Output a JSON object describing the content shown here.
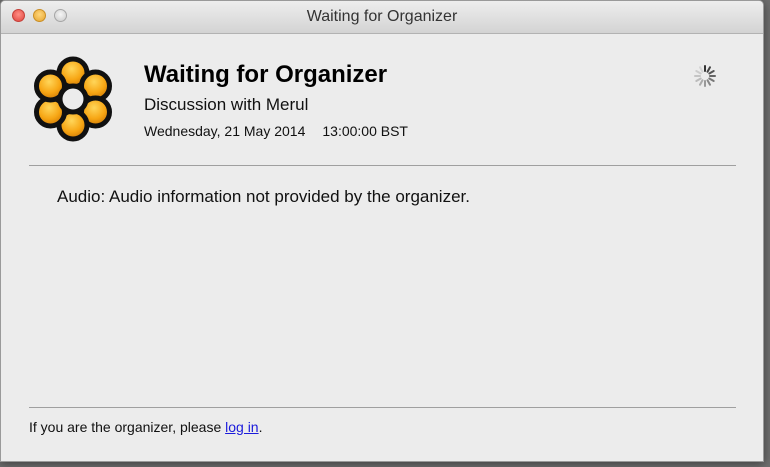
{
  "window": {
    "title": "Waiting for Organizer"
  },
  "meeting": {
    "heading": "Waiting for Organizer",
    "subject": "Discussion with Merul",
    "date": "Wednesday, 21 May 2014",
    "time": "13:00:00 BST"
  },
  "audio": {
    "text": "Audio: Audio information not provided by the organizer."
  },
  "footer": {
    "prefix": "If you are the organizer, please ",
    "link_label": "log in",
    "suffix": "."
  },
  "icons": {
    "logo": "gotomeeting-flower-logo-icon",
    "spinner": "loading-spinner-icon"
  },
  "colors": {
    "logo_petal": "#f7a614",
    "link": "#1a1adb",
    "window_bg": "#ececec"
  }
}
